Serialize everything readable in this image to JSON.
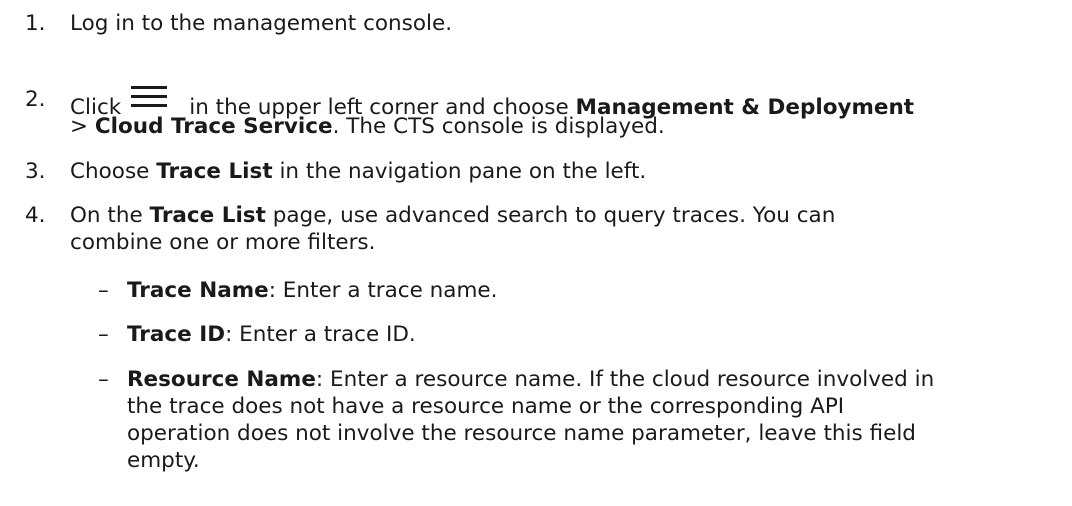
{
  "steps": [
    {
      "number": "1.",
      "text": "Log in to the management console."
    },
    {
      "number": "2.",
      "prefix": "Click",
      "icon": "menu-icon",
      "middle": "in the upper left corner and choose",
      "bold1": "Management & Deployment",
      "line2_prefix": ">",
      "bold2": "Cloud Trace Service",
      "line2_suffix": ". The CTS console is displayed."
    },
    {
      "number": "3.",
      "prefix": "Choose",
      "bold": "Trace List",
      "suffix": "in the navigation pane on the left."
    },
    {
      "number": "4.",
      "prefix": "On the",
      "bold": "Trace List",
      "suffix": "page, use advanced search to query traces. You can",
      "line2": "combine one or more filters."
    }
  ],
  "filters": [
    {
      "marker": "–",
      "name": "Trace Name",
      "desc": ": Enter a trace name."
    },
    {
      "marker": "–",
      "name": "Trace ID",
      "desc": ": Enter a trace ID."
    },
    {
      "marker": "–",
      "name": "Resource Name",
      "desc_lines": [
        ": Enter a resource name. If the cloud resource involved in",
        "the trace does not have a resource name or the corresponding API",
        "operation does not involve the resource name parameter, leave this field",
        "empty."
      ]
    }
  ]
}
